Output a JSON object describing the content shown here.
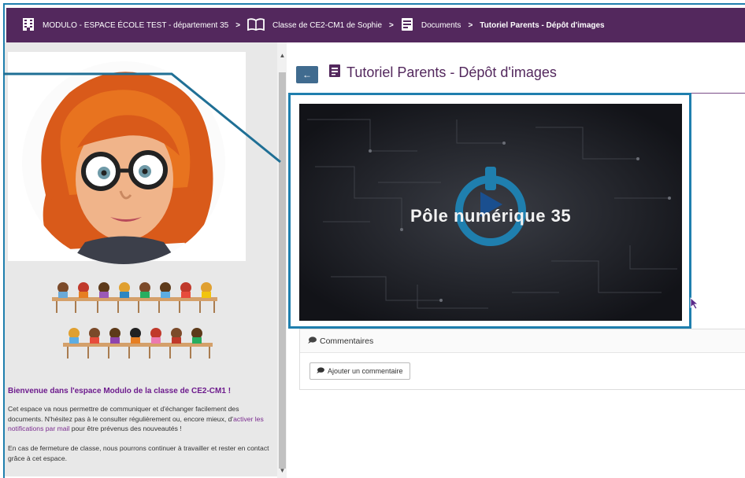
{
  "breadcrumb": {
    "school": "MODULO - ESPACE ÉCOLE TEST - département 35",
    "class": "Classe de CE2-CM1 de Sophie",
    "section": "Documents",
    "current": "Tutoriel Parents - Dépôt d'images",
    "separator": ">"
  },
  "sidebar": {
    "welcome": "Bienvenue dans l'espace Modulo de la classe de CE2-CM1 !",
    "para1_before": "Cet espace va nous permettre de communiquer et d'échanger facilement des documents. N'hésitez pas à le consulter régulièrement ou, encore mieux, d'",
    "para1_link": "activer les notifications par mail",
    "para1_after": " pour être prévenus des nouveautés !",
    "para2": "En cas de fermeture de classe, nous pourrons continuer à travailler et rester en contact grâce à cet espace."
  },
  "main": {
    "back_label": "←",
    "title": "Tutoriel Parents - Dépôt d'images",
    "video_label": "Pôle numérique 35",
    "comments_title": "Commentaires",
    "add_comment": "Ajouter un commentaire"
  },
  "colors": {
    "topbar": "#53285d",
    "accent": "#1f7fae",
    "title": "#53285d",
    "welcome": "#6d1b8d"
  }
}
